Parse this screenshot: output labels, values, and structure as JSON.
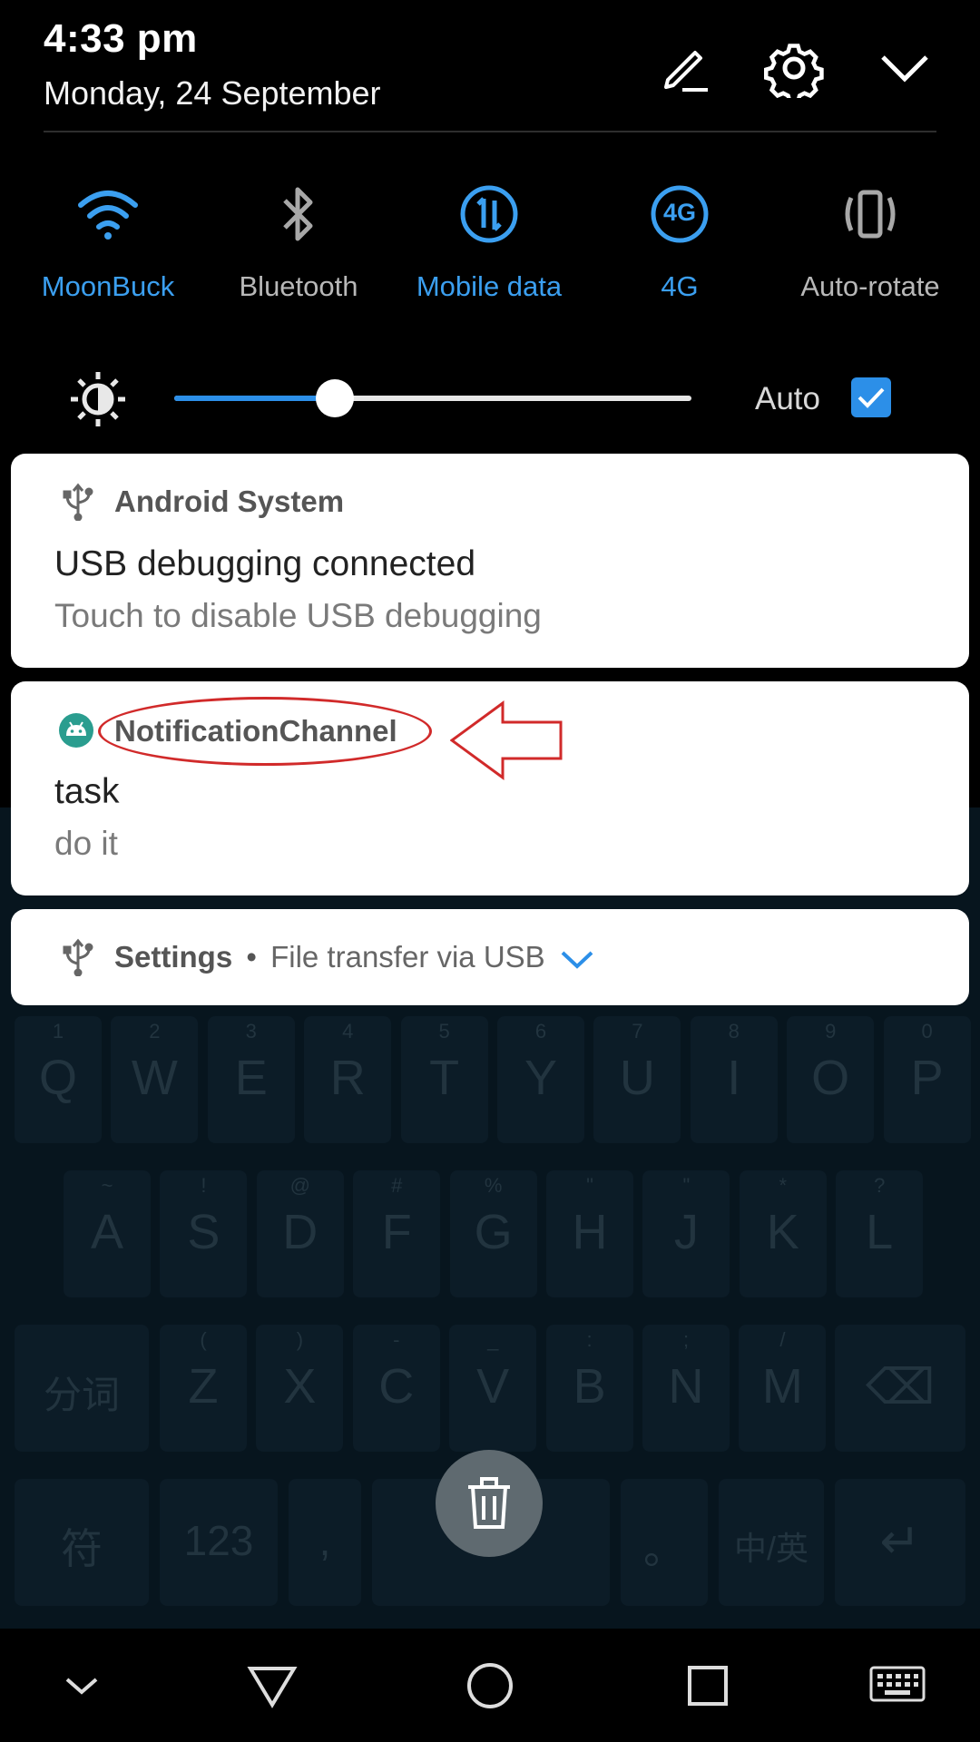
{
  "status": {
    "time": "4:33 pm",
    "date": "Monday, 24 September"
  },
  "quick_settings": [
    {
      "label": "MoonBuck",
      "icon": "wifi-icon",
      "active": true
    },
    {
      "label": "Bluetooth",
      "icon": "bluetooth-icon",
      "active": false
    },
    {
      "label": "Mobile data",
      "icon": "mobile-data-icon",
      "active": true
    },
    {
      "label": "4G",
      "icon": "4g-icon",
      "icon_text": "4G",
      "active": true
    },
    {
      "label": "Auto-rotate",
      "icon": "auto-rotate-icon",
      "active": false
    }
  ],
  "brightness": {
    "level": 0.31,
    "auto_label": "Auto",
    "auto_checked": true
  },
  "notifications": [
    {
      "app": "Android System",
      "icon": "usb-icon",
      "title": "USB debugging connected",
      "text": "Touch to disable USB debugging"
    },
    {
      "app": "NotificationChannel",
      "icon": "android-icon",
      "title": "task",
      "text": "do it"
    },
    {
      "app": "Settings",
      "icon": "usb-icon",
      "separator": "•",
      "summary": "File transfer via USB"
    }
  ],
  "keyboard": {
    "row1_hints": [
      "1",
      "2",
      "3",
      "4",
      "5",
      "6",
      "7",
      "8",
      "9",
      "0"
    ],
    "row1": [
      "Q",
      "W",
      "E",
      "R",
      "T",
      "Y",
      "U",
      "I",
      "O",
      "P"
    ],
    "row2_hints": [
      "~",
      "!",
      "@",
      "#",
      "%",
      "\"",
      "\"",
      "*",
      "?"
    ],
    "row2": [
      "A",
      "S",
      "D",
      "F",
      "G",
      "H",
      "J",
      "K",
      "L"
    ],
    "row3_hints": [
      "(",
      ")",
      "-",
      "_",
      ":",
      ";",
      "/"
    ],
    "row3_left": "分词",
    "row3": [
      "Z",
      "X",
      "C",
      "V",
      "B",
      "N",
      "M"
    ],
    "row4_left": "符",
    "row4_num": "123",
    "row4_comma": ",",
    "row4_period": "。",
    "row4_lang_top": "中",
    "row4_lang_bottom": "英"
  },
  "colors": {
    "accent": "#2c8fe8",
    "active_toggle": "#3b9ff0",
    "annotation": "#d12a2a"
  }
}
